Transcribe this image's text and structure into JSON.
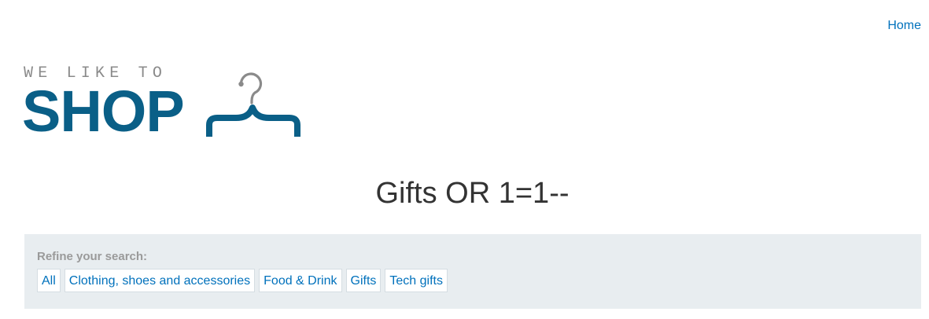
{
  "header": {
    "nav": [
      {
        "label": "Home"
      }
    ]
  },
  "logo": {
    "tagline": "WE LIKE TO",
    "word": "SHOP",
    "icon": "clothes-hanger-icon",
    "colors": {
      "word": "#0a5f87",
      "tagline": "#8a8a8a",
      "hook": "#8a8a8a"
    }
  },
  "main": {
    "title": "Gifts OR 1=1--"
  },
  "refine": {
    "label": "Refine your search:",
    "filters": [
      {
        "label": "All"
      },
      {
        "label": "Clothing, shoes and accessories"
      },
      {
        "label": "Food & Drink"
      },
      {
        "label": "Gifts"
      },
      {
        "label": "Tech gifts"
      }
    ]
  },
  "colors": {
    "link": "#0071bc",
    "panel_background": "#e8edf0",
    "title_text": "#333333"
  }
}
